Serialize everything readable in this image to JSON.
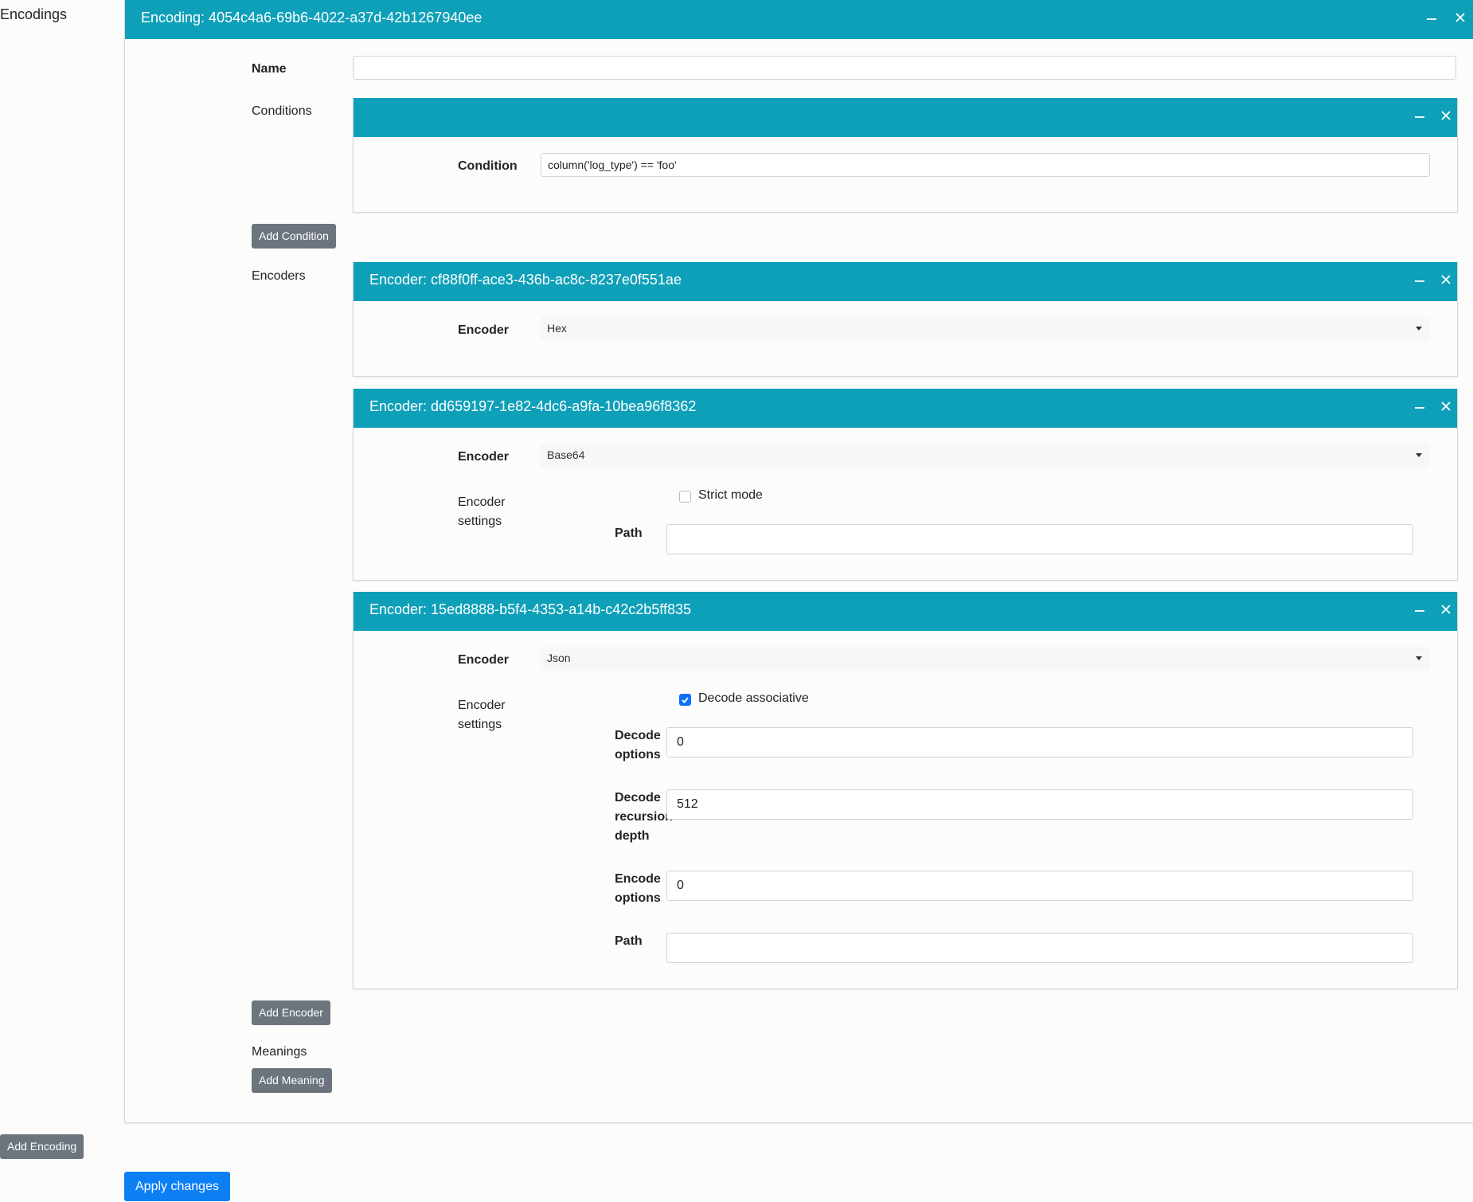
{
  "sidebar": {
    "title": "Encodings",
    "add_encoding_label": "Add Encoding"
  },
  "encoding": {
    "title": "Encoding: 4054c4a6-69b6-4022-a37d-42b1267940ee",
    "name_label": "Name",
    "name_value": "",
    "conditions_label": "Conditions",
    "condition": {
      "label": "Condition",
      "value": "column('log_type') == 'foo'"
    },
    "add_condition_label": "Add Condition",
    "encoders_label": "Encoders",
    "encoders": [
      {
        "title": "Encoder: cf88f0ff-ace3-436b-ac8c-8237e0f551ae",
        "encoder_label": "Encoder",
        "encoder_value": "Hex"
      },
      {
        "title": "Encoder: dd659197-1e82-4dc6-a9fa-10bea96f8362",
        "encoder_label": "Encoder",
        "encoder_value": "Base64",
        "settings_label_1": "Encoder",
        "settings_label_2": "settings",
        "strict_mode_label": "Strict mode",
        "strict_mode_checked": false,
        "path_label": "Path",
        "path_value": ""
      },
      {
        "title": "Encoder: 15ed8888-b5f4-4353-a14b-c42c2b5ff835",
        "encoder_label": "Encoder",
        "encoder_value": "Json",
        "settings_label_1": "Encoder",
        "settings_label_2": "settings",
        "decode_associative_label": "Decode associative",
        "decode_associative_checked": true,
        "decode_options_label_1": "Decode",
        "decode_options_label_2": "options",
        "decode_options_value": "0",
        "decode_depth_label_1": "Decode",
        "decode_depth_label_2": "recursion",
        "decode_depth_label_3": "depth",
        "decode_depth_value": "512",
        "encode_options_label_1": "Encode",
        "encode_options_label_2": "options",
        "encode_options_value": "0",
        "path_label": "Path",
        "path_value": ""
      }
    ],
    "add_encoder_label": "Add Encoder",
    "meanings_label": "Meanings",
    "add_meaning_label": "Add Meaning"
  },
  "apply_changes_label": "Apply changes",
  "colors": {
    "header": "#0fa0b9",
    "primary": "#0d7ff5",
    "secondary": "#6c757d"
  }
}
